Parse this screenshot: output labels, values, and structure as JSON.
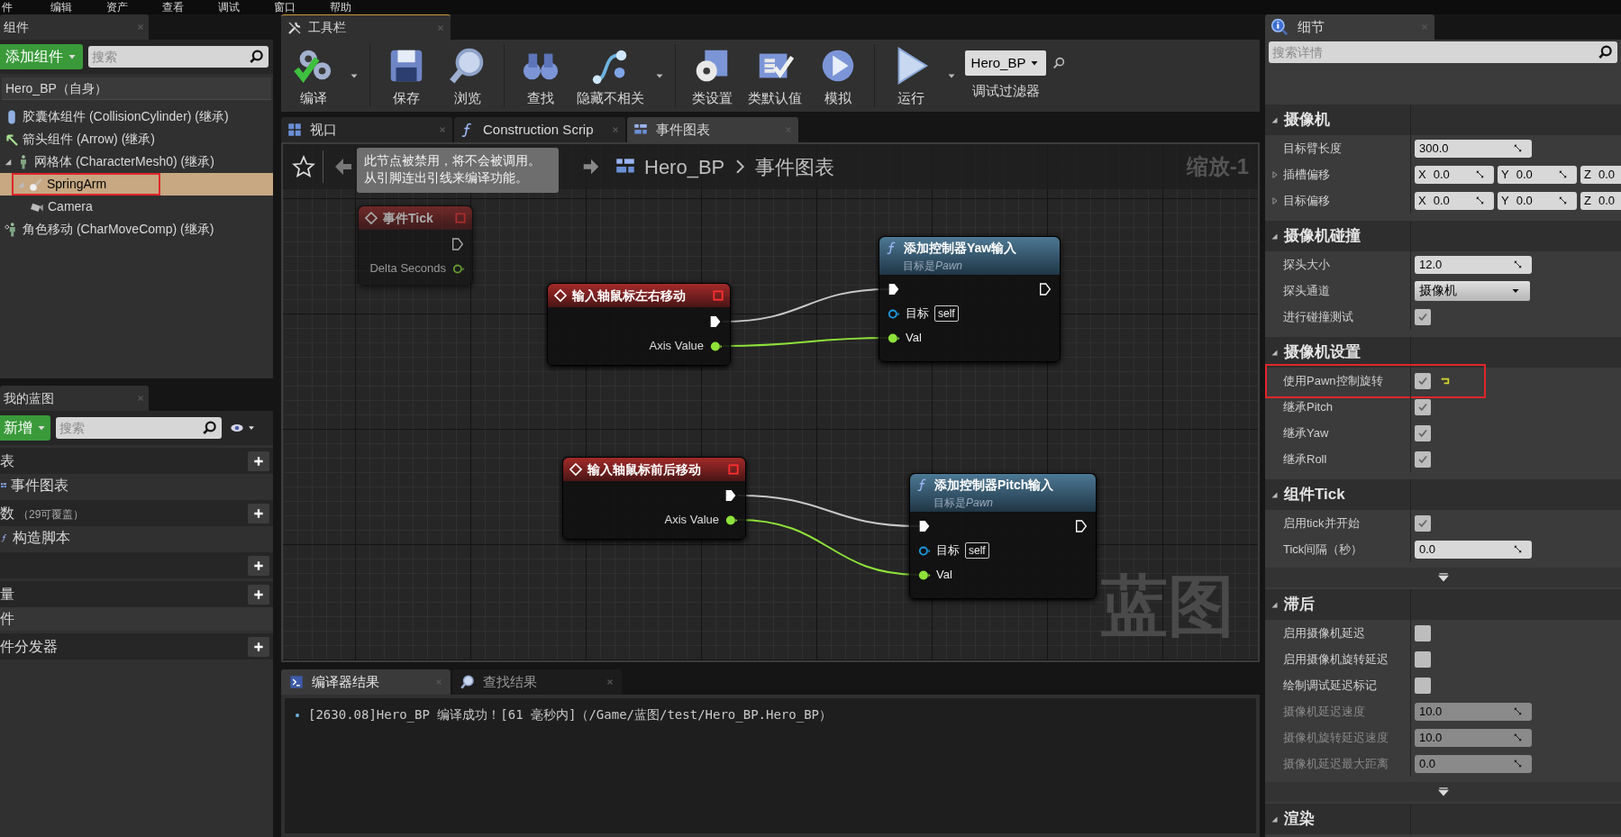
{
  "menu_bar": [
    "件",
    "编辑",
    "资产",
    "查看",
    "调试",
    "窗口",
    "帮助"
  ],
  "components_panel": {
    "tab": "组件",
    "add_button": "添加组件",
    "search_placeholder": "搜索",
    "root": "Hero_BP（自身）",
    "tree": [
      {
        "label": "胶囊体组件 (CollisionCylinder) (继承)",
        "kind": "capsule",
        "selected": false
      },
      {
        "label": "箭头组件 (Arrow) (继承)",
        "kind": "arrow",
        "selected": false
      },
      {
        "label": "网格体 (CharacterMesh0) (继承)",
        "kind": "mesh",
        "selected": false,
        "expanded": true,
        "children": [
          {
            "label": "SpringArm",
            "kind": "spring",
            "selected": true,
            "highlighted": true,
            "expanded": true,
            "children": [
              {
                "label": "Camera",
                "kind": "camera",
                "selected": false
              }
            ]
          }
        ]
      },
      {
        "label": "角色移动 (CharMoveComp) (继承)",
        "kind": "movement",
        "selected": false
      }
    ]
  },
  "my_blueprint": {
    "tab": "我的蓝图",
    "add_button": "新增",
    "search_placeholder": "搜索",
    "categories": [
      {
        "label": "表",
        "items": [
          {
            "label": "事件图表",
            "kind": "graph"
          }
        ]
      },
      {
        "label": "数",
        "note": "（29可覆盖）",
        "items": [
          {
            "label": "构造脚本",
            "kind": "function"
          }
        ]
      },
      {
        "kind": "header"
      },
      {
        "label": "量",
        "items": [
          {
            "label": "件",
            "kind": "subcategory"
          }
        ]
      },
      {
        "label": "件分发器"
      }
    ]
  },
  "toolbar": {
    "tab": "工具栏",
    "groups": [
      [
        {
          "label": "编译",
          "kind": "compile",
          "dropdown": true
        }
      ],
      [
        {
          "label": "保存",
          "kind": "save"
        },
        {
          "label": "浏览",
          "kind": "browse"
        }
      ],
      [
        {
          "label": "查找",
          "kind": "find"
        },
        {
          "label": "隐藏不相关",
          "kind": "hide",
          "dropdown": true
        }
      ],
      [
        {
          "label": "类设置",
          "kind": "class_settings"
        },
        {
          "label": "类默认值",
          "kind": "class_defaults"
        },
        {
          "label": "模拟",
          "kind": "simulate"
        }
      ],
      [
        {
          "label": "运行",
          "kind": "play",
          "dropdown": true
        }
      ]
    ],
    "debug_filter": {
      "value": "Hero_BP",
      "label": "调试过滤器"
    }
  },
  "document_tabs": [
    {
      "label": "视口",
      "kind": "viewport",
      "selected": false
    },
    {
      "label": "Construction Scrip",
      "kind": "function",
      "selected": false
    },
    {
      "label": "事件图表",
      "kind": "graph",
      "selected": true
    }
  ],
  "graph": {
    "breadcrumb": [
      "Hero_BP",
      "事件图表"
    ],
    "zoom": "缩放-1",
    "watermark": "蓝图",
    "tooltip": [
      "此节点被禁用，将不会被调用。",
      "从引脚连出引线来编译功能。"
    ],
    "nodes": [
      {
        "kind": "event",
        "title": "事件Tick",
        "disabled": true,
        "outputs": [
          {
            "kind": "exec",
            "connected": false
          },
          {
            "kind": "float",
            "label": "Delta Seconds",
            "connected": false
          }
        ]
      },
      {
        "kind": "event",
        "title": "输入轴鼠标左右移动",
        "disabled": false,
        "outputs": [
          {
            "kind": "exec",
            "connected": true
          },
          {
            "kind": "float",
            "label": "Axis Value",
            "connected": true
          }
        ]
      },
      {
        "kind": "function",
        "title": "添加控制器Yaw输入",
        "subtitle": "目标是",
        "subtitle_target": "Pawn",
        "disabled": false,
        "inputs": [
          {
            "kind": "exec",
            "connected": true
          },
          {
            "kind": "object",
            "label": "目标",
            "default": "self",
            "connected": false
          },
          {
            "kind": "float",
            "label": "Val",
            "connected": true
          }
        ],
        "outputs": [
          {
            "kind": "exec",
            "connected": false
          }
        ]
      },
      {
        "kind": "event",
        "title": "输入轴鼠标前后移动",
        "disabled": false,
        "outputs": [
          {
            "kind": "exec",
            "connected": true
          },
          {
            "kind": "float",
            "label": "Axis Value",
            "connected": true
          }
        ]
      },
      {
        "kind": "function",
        "title": "添加控制器Pitch输入",
        "subtitle": "目标是",
        "subtitle_target": "Pawn",
        "disabled": false,
        "inputs": [
          {
            "kind": "exec",
            "connected": true
          },
          {
            "kind": "object",
            "label": "目标",
            "default": "self",
            "connected": false
          },
          {
            "kind": "float",
            "label": "Val",
            "connected": true
          }
        ],
        "outputs": [
          {
            "kind": "exec",
            "connected": false
          }
        ]
      }
    ]
  },
  "results": {
    "tabs": [
      {
        "label": "编译器结果",
        "kind": "log",
        "selected": true
      },
      {
        "label": "查找结果",
        "kind": "find",
        "selected": false
      }
    ],
    "messages": [
      "[2630.08]Hero_BP 编译成功！[61 毫秒内]（/Game/蓝图/test/Hero_BP.Hero_BP）"
    ]
  },
  "details": {
    "tab": "细节",
    "search_placeholder": "搜索详情",
    "sections": [
      {
        "title": "摄像机",
        "expanded": true,
        "advanced": false,
        "rows": [
          {
            "kind": "number",
            "label": "目标臂长度",
            "value": "300.0",
            "disabled": false
          },
          {
            "kind": "vector",
            "label": "插槽偏移",
            "expanded": false,
            "values": [
              {
                "axis": "X",
                "value": "0.0"
              },
              {
                "axis": "Y",
                "value": "0.0"
              },
              {
                "axis": "Z",
                "value": "0.0"
              }
            ]
          },
          {
            "kind": "vector",
            "label": "目标偏移",
            "expanded": false,
            "values": [
              {
                "axis": "X",
                "value": "0.0"
              },
              {
                "axis": "Y",
                "value": "0.0"
              },
              {
                "axis": "Z",
                "value": "0.0"
              }
            ]
          }
        ]
      },
      {
        "title": "摄像机碰撞",
        "expanded": true,
        "advanced": false,
        "rows": [
          {
            "kind": "number",
            "label": "探头大小",
            "value": "12.0",
            "disabled": false
          },
          {
            "kind": "dropdown",
            "label": "探头通道",
            "value": "摄像机"
          },
          {
            "kind": "checkbox",
            "label": "进行碰撞测试",
            "checked": true
          }
        ]
      },
      {
        "title": "摄像机设置",
        "expanded": true,
        "advanced": false,
        "rows": [
          {
            "kind": "checkbox",
            "label": "使用Pawn控制旋转",
            "checked": true,
            "highlighted": true,
            "reset": true
          },
          {
            "kind": "checkbox",
            "label": "继承Pitch",
            "checked": true
          },
          {
            "kind": "checkbox",
            "label": "继承Yaw",
            "checked": true
          },
          {
            "kind": "checkbox",
            "label": "继承Roll",
            "checked": true
          }
        ]
      },
      {
        "title": "组件Tick",
        "expanded": true,
        "advanced": true,
        "rows": [
          {
            "kind": "checkbox",
            "label": "启用tick并开始",
            "checked": true
          },
          {
            "kind": "number",
            "label": "Tick间隔（秒）",
            "value": "0.0",
            "disabled": false
          }
        ]
      },
      {
        "title": "滞后",
        "expanded": true,
        "advanced": true,
        "rows": [
          {
            "kind": "checkbox",
            "label": "启用摄像机延迟",
            "checked": false
          },
          {
            "kind": "checkbox",
            "label": "启用摄像机旋转延迟",
            "checked": false
          },
          {
            "kind": "checkbox",
            "label": "绘制调试延迟标记",
            "checked": false
          },
          {
            "kind": "number",
            "label": "摄像机延迟速度",
            "value": "10.0",
            "disabled": true
          },
          {
            "kind": "number",
            "label": "摄像机旋转延迟速度",
            "value": "10.0",
            "disabled": true
          },
          {
            "kind": "number",
            "label": "摄像机延迟最大距离",
            "value": "0.0",
            "disabled": true
          }
        ]
      },
      {
        "title": "渲染",
        "expanded": true,
        "advanced": false
      }
    ]
  }
}
